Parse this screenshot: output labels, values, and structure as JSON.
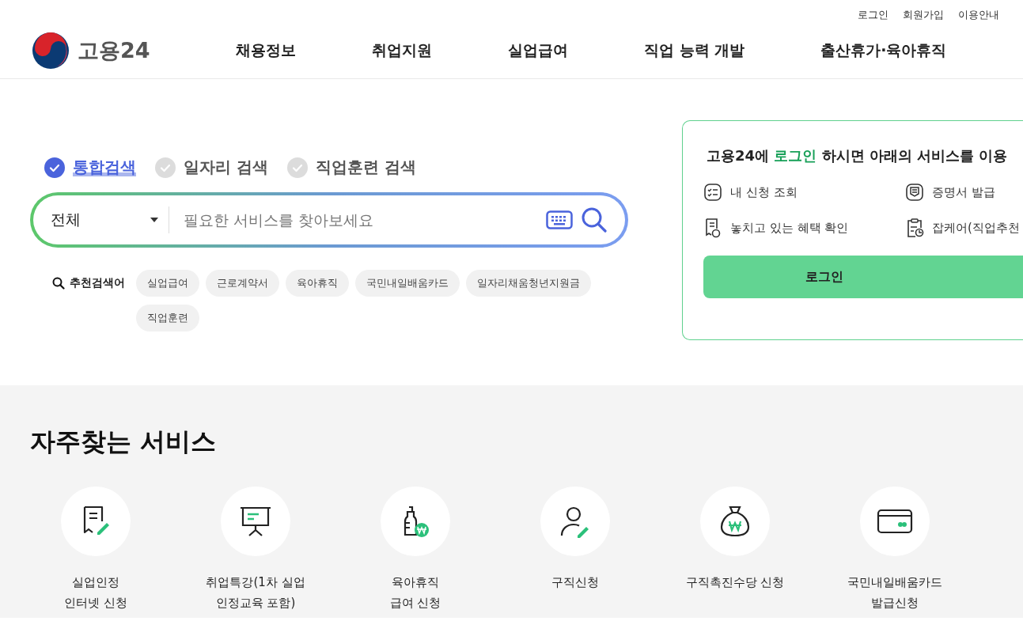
{
  "util_links": [
    "로그인",
    "회원가입",
    "이용안내"
  ],
  "logo": {
    "text": "고용24"
  },
  "nav": [
    "채용정보",
    "취업지원",
    "실업급여",
    "직업 능력 개발",
    "출산휴가·육아휴직"
  ],
  "search_tabs": [
    {
      "label": "통합검색",
      "selected": true
    },
    {
      "label": "일자리 검색",
      "selected": false
    },
    {
      "label": "직업훈련 검색",
      "selected": false
    }
  ],
  "search": {
    "category": "전체",
    "placeholder": "필요한 서비스를 찾아보세요"
  },
  "recommended": {
    "label": "추천검색어",
    "keywords": [
      "실업급여",
      "근로계약서",
      "육아휴직",
      "국민내일배움카드",
      "일자리채움청년지원금",
      "직업훈련"
    ]
  },
  "login_card": {
    "message": {
      "before": "고용24에 ",
      "highlight": "로그인",
      "after": " 하시면 아래의 서비스를 이용"
    },
    "services": [
      {
        "kind": "checklist",
        "label": "내 신청 조회"
      },
      {
        "kind": "certificate",
        "label": "증명서 발급"
      },
      {
        "kind": "receipt",
        "label": "놓치고 있는 혜택 확인"
      },
      {
        "kind": "clipboard",
        "label": "잡케어(직업추천"
      }
    ],
    "button": "로그인"
  },
  "frequent": {
    "title": "자주찾는 서비스",
    "items": [
      {
        "kind": "document",
        "label": "실업인정\n인터넷 신청"
      },
      {
        "kind": "presentation",
        "label": "취업특강(1차 실업\n인정교육 포함)"
      },
      {
        "kind": "bottle",
        "label": "육아휴직\n급여 신청"
      },
      {
        "kind": "person",
        "label": "구직신청"
      },
      {
        "kind": "moneybag",
        "label": "구직촉진수당 신청"
      },
      {
        "kind": "card",
        "label": "국민내일배움카드\n발급신청"
      }
    ]
  }
}
